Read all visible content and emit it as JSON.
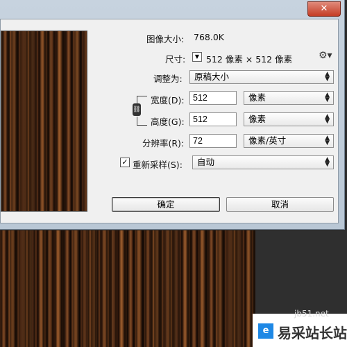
{
  "window": {
    "close_glyph": "✕"
  },
  "dialog": {
    "image_size_label": "图像大小:",
    "image_size_value": "768.0K",
    "dimensions_label": "尺寸:",
    "dimensions_value": "512 像素 × 512 像素",
    "fit_to_label": "调整为:",
    "fit_to_value": "原稿大小",
    "width_label": "宽度(D):",
    "width_value": "512",
    "width_unit": "像素",
    "height_label": "高度(G):",
    "height_value": "512",
    "height_unit": "像素",
    "resolution_label": "分辨率(R):",
    "resolution_value": "72",
    "resolution_unit": "像素/英寸",
    "resample_label": "重新采样(S):",
    "resample_value": "自动",
    "resample_checked": true,
    "ok_label": "确定",
    "cancel_label": "取消",
    "gear_icon": "gear-icon",
    "link_icon": "chain-link-icon"
  },
  "watermark": {
    "text": "易采站长站",
    "url": "jb51.net"
  }
}
